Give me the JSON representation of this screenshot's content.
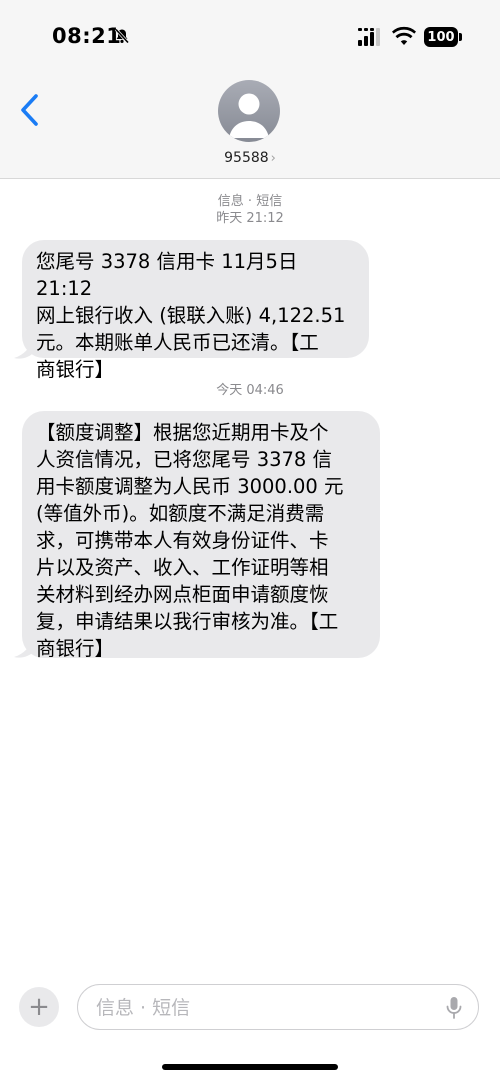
{
  "status_bar": {
    "time": "08:21",
    "battery": "100"
  },
  "header": {
    "contact": "95588",
    "chevron": "›"
  },
  "messages": [
    {
      "meta_line1": "信息 · 短信",
      "meta_line2": "昨天 21:12",
      "lines": [
        "您尾号 3378 信用卡 11月5日 21:12",
        "网上银行收入 (银联入账) 4,122.51",
        "元。本期账单人民币已还清。【工",
        "商银行】"
      ]
    },
    {
      "meta_line1": "今天 04:46",
      "lines": [
        "【额度调整】根据您近期用卡及个",
        "人资信情况，已将您尾号 3378 信",
        "用卡额度调整为人民币 3000.00 元",
        "(等值外币)。如额度不满足消费需",
        "求，可携带本人有效身份证件、卡",
        "片以及资产、收入、工作证明等相",
        "关材料到经办网点柜面申请额度恢",
        "复，申请结果以我行审核为准。【工",
        "商银行】"
      ]
    }
  ],
  "compose": {
    "plus": "+",
    "placeholder": "信息 · 短信"
  },
  "icons": {
    "back": "chevron-left-icon",
    "bell": "bell-slash-icon",
    "signal": "cellular-signal-icon",
    "wifi": "wifi-icon",
    "mic": "microphone-icon"
  },
  "colors": {
    "accent": "#1a7cf5",
    "bubble": "#e9e9eb",
    "meta": "#8a8a8e"
  }
}
